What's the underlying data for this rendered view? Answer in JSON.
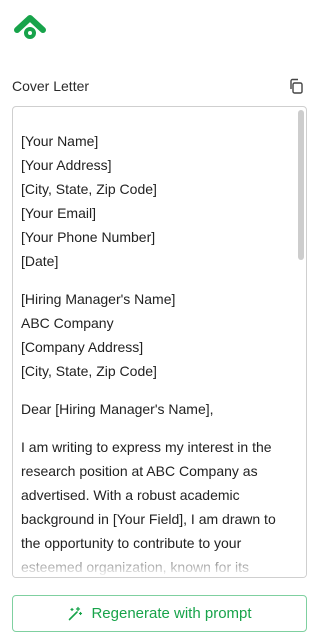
{
  "brand": {
    "logo_icon": "leaf-logo-icon",
    "accent": "#17a34a"
  },
  "section": {
    "label": "Cover Letter",
    "copy_icon": "copy-icon"
  },
  "letter": {
    "header_lines": [
      "[Your Name]",
      "[Your Address]",
      "[City, State, Zip Code]",
      "[Your Email]",
      "[Your Phone Number]",
      "[Date]"
    ],
    "recipient_lines": [
      "[Hiring Manager's Name]",
      "ABC Company",
      "[Company Address]",
      "[City, State, Zip Code]"
    ],
    "greeting": "Dear [Hiring Manager's Name],",
    "body": "I am writing to express my interest in the research position at ABC Company as advertised. With a robust academic background in [Your Field], I am drawn to the opportunity to contribute to your esteemed organization, known for its excellence in [specific area or other"
  },
  "footer": {
    "regenerate_label": "Regenerate with prompt",
    "regenerate_icon": "magic-wand-icon"
  }
}
